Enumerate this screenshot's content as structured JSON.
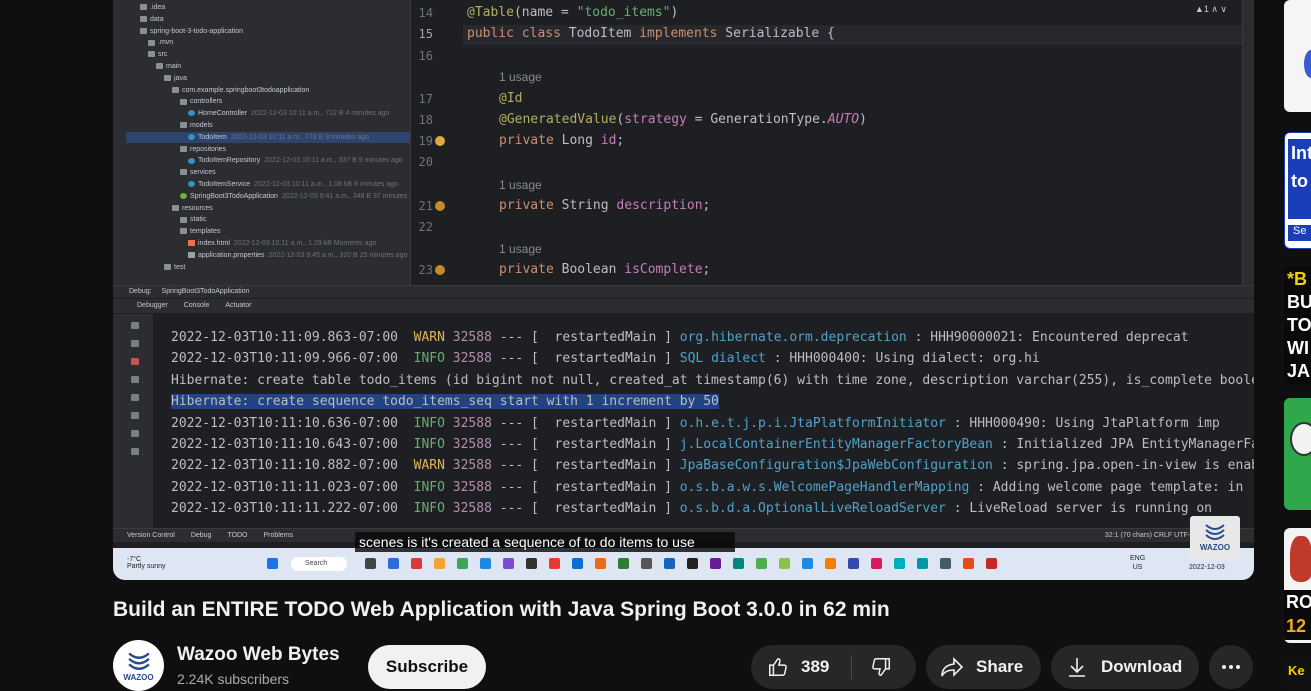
{
  "project_tree": {
    "rows": [
      {
        "label": ".idea",
        "meta": "",
        "icon": "folder"
      },
      {
        "label": "data",
        "meta": "",
        "icon": "folder"
      },
      {
        "label": "spring-boot-3-todo-application",
        "meta": "",
        "icon": "folder"
      },
      {
        "label": ".mvn",
        "meta": "",
        "icon": "folder"
      },
      {
        "label": "src",
        "meta": "",
        "icon": "folder"
      },
      {
        "label": "main",
        "meta": "",
        "icon": "folder"
      },
      {
        "label": "java",
        "meta": "",
        "icon": "folder"
      },
      {
        "label": "com.example.springboot3todoapplication",
        "meta": "",
        "icon": "folder"
      },
      {
        "label": "controllers",
        "meta": "",
        "icon": "folder"
      },
      {
        "label": "HomeController",
        "meta": "2022-12-03 10:11 a.m., 712 B 4 minutes ago",
        "icon": "java"
      },
      {
        "label": "models",
        "meta": "",
        "icon": "folder"
      },
      {
        "label": "TodoItem",
        "meta": "2022-12-03 10:11 a.m., 773 B 9 minutes ago",
        "icon": "java"
      },
      {
        "label": "repositories",
        "meta": "",
        "icon": "folder"
      },
      {
        "label": "TodoItemRepository",
        "meta": "2022-12-03 10:11 a.m., 337 B 9 minutes ago",
        "icon": "java"
      },
      {
        "label": "services",
        "meta": "",
        "icon": "folder"
      },
      {
        "label": "TodoItemService",
        "meta": "2022-12-03 10:11 a.m., 1.08 kB 8 minutes ago",
        "icon": "java"
      },
      {
        "label": "SpringBoot3TodoApplication",
        "meta": "2022-12-03 9:41 a.m., 348 B 37 minutes ago",
        "icon": "spring"
      },
      {
        "label": "resources",
        "meta": "",
        "icon": "folder"
      },
      {
        "label": "static",
        "meta": "",
        "icon": "folder"
      },
      {
        "label": "templates",
        "meta": "",
        "icon": "folder"
      },
      {
        "label": "index.html",
        "meta": "2022-12-03 10:11 a.m., 1.29 kB Moments ago",
        "icon": "html"
      },
      {
        "label": "application.properties",
        "meta": "2022-12-03 9:45 a.m., 320 B 25 minutes ago",
        "icon": "prop"
      },
      {
        "label": "test",
        "meta": "",
        "icon": "folder"
      }
    ]
  },
  "editor": {
    "warnings": "▲1 ∧ ∨",
    "lines": [
      {
        "n": "14",
        "html_parts": [
          [
            "an",
            "@Table"
          ],
          [
            "cls",
            "(name = "
          ],
          [
            "str",
            "\"todo_items\""
          ],
          [
            "cls",
            ")"
          ]
        ]
      },
      {
        "n": "15",
        "html_parts": [
          [
            "kw",
            "public class "
          ],
          [
            "cls",
            "TodoItem "
          ],
          [
            "kw",
            "implements "
          ],
          [
            "cls",
            "Serializable {"
          ]
        ]
      },
      {
        "n": "16",
        "html_parts": []
      },
      {
        "n": "17",
        "html_parts": [
          [
            "an",
            "@Id"
          ]
        ]
      },
      {
        "n": "18",
        "html_parts": [
          [
            "an",
            "@GeneratedValue"
          ],
          [
            "cls",
            "("
          ],
          [
            "fld",
            "strategy"
          ],
          [
            "cls",
            " = GenerationType."
          ],
          [
            "it",
            "AUTO"
          ],
          [
            "cls",
            ")"
          ]
        ]
      },
      {
        "n": "19",
        "html_parts": [
          [
            "kw",
            "private "
          ],
          [
            "cls",
            "Long "
          ],
          [
            "fld",
            "id"
          ],
          [
            "cls",
            ";"
          ]
        ]
      },
      {
        "n": "20",
        "html_parts": []
      },
      {
        "n": "21",
        "html_parts": [
          [
            "kw",
            "private "
          ],
          [
            "cls",
            "String "
          ],
          [
            "fld",
            "description"
          ],
          [
            "cls",
            ";"
          ]
        ]
      },
      {
        "n": "22",
        "html_parts": []
      },
      {
        "n": "23",
        "html_parts": [
          [
            "kw",
            "private "
          ],
          [
            "cls",
            "Boolean "
          ],
          [
            "fld",
            "isComplete"
          ],
          [
            "cls",
            ";"
          ]
        ]
      }
    ],
    "usage_label": "1 usage"
  },
  "debug": {
    "title": "Debug:",
    "config": "SpringBoot3TodoApplication",
    "tabs": [
      "Debugger",
      "Console",
      "Actuator"
    ],
    "console_lines": [
      {
        "ts": "2022-12-03T10:11:09.863-07:00",
        "level": "WARN",
        "pid": "32588",
        "thread": "restartedMain",
        "logger": "org.hibernate.orm.deprecation",
        "msg": ": HHH90000021: Encountered deprecat"
      },
      {
        "ts": "2022-12-03T10:11:09.966-07:00",
        "level": "INFO",
        "pid": "32588",
        "thread": "restartedMain",
        "logger": "SQL dialect",
        "msg": ": HHH000400: Using dialect: org.hi"
      },
      {
        "raw": "Hibernate: create table todo_items (id bigint not null, created_at timestamp(6) with time zone, description varchar(255), is_complete boole"
      },
      {
        "raw": "Hibernate: create sequence todo_items_seq start with 1 increment by 50",
        "highlight": true
      },
      {
        "ts": "2022-12-03T10:11:10.636-07:00",
        "level": "INFO",
        "pid": "32588",
        "thread": "restartedMain",
        "logger": "o.h.e.t.j.p.i.JtaPlatformInitiator",
        "msg": ": HHH000490: Using JtaPlatform imp"
      },
      {
        "ts": "2022-12-03T10:11:10.643-07:00",
        "level": "INFO",
        "pid": "32588",
        "thread": "restartedMain",
        "logger": "j.LocalContainerEntityManagerFactoryBean",
        "msg": ": Initialized JPA EntityManagerFac"
      },
      {
        "ts": "2022-12-03T10:11:10.882-07:00",
        "level": "WARN",
        "pid": "32588",
        "thread": "restartedMain",
        "logger": "JpaBaseConfiguration$JpaWebConfiguration",
        "msg": ": spring.jpa.open-in-view is enabl"
      },
      {
        "ts": "2022-12-03T10:11:11.023-07:00",
        "level": "INFO",
        "pid": "32588",
        "thread": "restartedMain",
        "logger": "o.s.b.a.w.s.WelcomePageHandlerMapping",
        "msg": ": Adding welcome page template: in"
      },
      {
        "ts": "2022-12-03T10:11:11.222-07:00",
        "level": "INFO",
        "pid": "32588",
        "thread": "restartedMain",
        "logger": "o.s.b.d.a.OptionalLiveReloadServer",
        "msg": ": LiveReload server is running on"
      }
    ]
  },
  "ide_status": {
    "tabs": [
      "Version Control",
      "Debug",
      "TODO",
      "Problems"
    ],
    "right": "32:1 (70 chars)   CRLF   UTF-8"
  },
  "taskbar": {
    "temp": "-7°C",
    "weather": "Partly sunny",
    "search": "Search",
    "lang1": "ENG",
    "lang2": "US",
    "time": "10:11 AM",
    "date": "2022-12-03"
  },
  "caption": "scenes is it's created a sequence of to do items to use",
  "watermark": "WAZOO",
  "video_title": "Build an ENTIRE TODO Web Application with Java Spring Boot 3.0.0 in 62 min",
  "channel": {
    "name": "Wazoo Web Bytes",
    "subscribers": "2.24K subscribers",
    "avatar_text": "WAZOO"
  },
  "actions": {
    "subscribe": "Subscribe",
    "likes": "389",
    "share": "Share",
    "download": "Download"
  },
  "sidebar_thumbs": {
    "t2_line1": "Int",
    "t2_line2": "to",
    "t2_line3": "Se",
    "t3_line1": "*B",
    "t3_line2": "BU",
    "t3_line3": "TO",
    "t3_line4": "WI",
    "t3_line5": "JA",
    "t6_line1": "RO",
    "t6_line2": "12",
    "t7_line1": "Ke"
  }
}
